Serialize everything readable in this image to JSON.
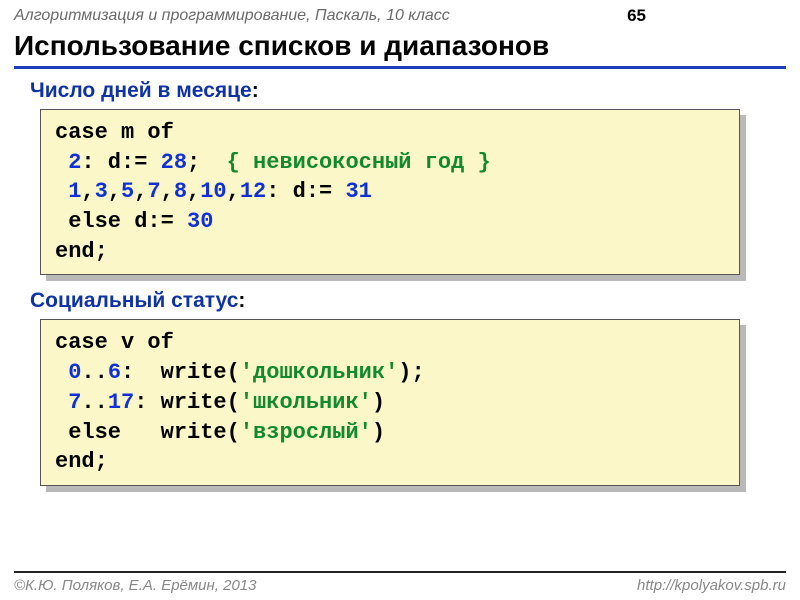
{
  "header": {
    "course": "Алгоритмизация и программирование, Паскаль, 10 класс",
    "page": "65"
  },
  "title": "Использование списков и диапазонов",
  "sections": {
    "days": {
      "label": "Число дней в месяце",
      "colon": ":"
    },
    "status": {
      "label": "Социальный статус",
      "colon": ":"
    }
  },
  "code1": {
    "l1": {
      "a": "case",
      "b": " m ",
      "c": "of"
    },
    "l2": {
      "a": " ",
      "b": "2",
      "c": ": d:= ",
      "d": "28",
      "e": ";  ",
      "f": "{ невисокосный год }"
    },
    "l3": {
      "a": " ",
      "b": "1",
      "c": ",",
      "d": "3",
      "e": ",",
      "f": "5",
      "g": ",",
      "h": "7",
      "i": ",",
      "j": "8",
      "k": ",",
      "l": "10",
      "m": ",",
      "n": "12",
      "o": ": d:= ",
      "p": "31"
    },
    "l4": {
      "a": " ",
      "b": "else",
      "c": " d:= ",
      "d": "30"
    },
    "l5": {
      "a": "end;"
    }
  },
  "code2": {
    "l1": {
      "a": "case",
      "b": " v ",
      "c": "of"
    },
    "l2": {
      "a": " ",
      "b": "0",
      "c": "..",
      "d": "6",
      "e": ":  write(",
      "f": "'дошкольник'",
      "g": ");"
    },
    "l3": {
      "a": " ",
      "b": "7",
      "c": "..",
      "d": "17",
      "e": ": write(",
      "f": "'школьник'",
      "g": ")"
    },
    "l4": {
      "a": " ",
      "b": "else",
      "c": "   write(",
      "d": "'взрослый'",
      "e": ")"
    },
    "l5": {
      "a": "end;"
    }
  },
  "footer": {
    "left": "К.Ю. Поляков, Е.А. Ерёмин, 2013",
    "right": "http://kpolyakov.spb.ru"
  }
}
